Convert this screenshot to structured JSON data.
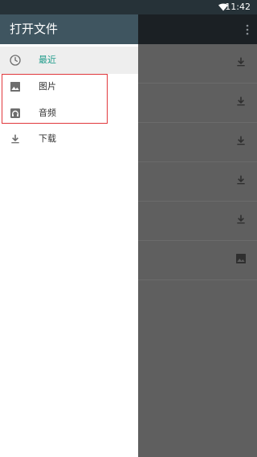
{
  "status_bar": {
    "time": "11:42",
    "wifi_icon": "wifi-icon"
  },
  "drawer": {
    "title": "打开文件",
    "items": [
      {
        "label": "最近",
        "icon": "clock-icon",
        "selected": true
      },
      {
        "label": "图片",
        "icon": "image-icon",
        "selected": false
      },
      {
        "label": "音频",
        "icon": "audio-icon",
        "selected": false
      },
      {
        "label": "下载",
        "icon": "download-icon",
        "selected": false
      }
    ]
  },
  "toolbar": {
    "menu_icon": "overflow-menu-icon"
  },
  "content": {
    "rows": [
      {
        "icon": "download-icon"
      },
      {
        "icon": "download-icon"
      },
      {
        "icon": "download-icon"
      },
      {
        "icon": "download-icon"
      },
      {
        "icon": "download-icon"
      },
      {
        "icon": "image-icon"
      }
    ]
  },
  "colors": {
    "header": "#3f5560",
    "status_bar": "#263238",
    "accent": "#1e9b8a",
    "highlight_border": "#e1373b",
    "scrim": "#5f5f5f"
  }
}
